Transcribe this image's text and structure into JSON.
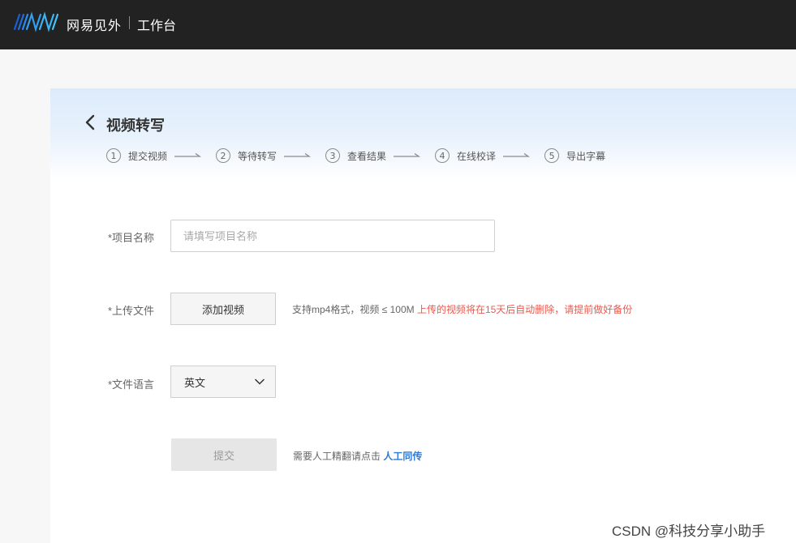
{
  "header": {
    "brand": "网易见外",
    "workbench": "工作台"
  },
  "page": {
    "title": "视频转写",
    "steps": [
      {
        "num": "1",
        "label": "提交视频"
      },
      {
        "num": "2",
        "label": "等待转写"
      },
      {
        "num": "3",
        "label": "查看结果"
      },
      {
        "num": "4",
        "label": "在线校译"
      },
      {
        "num": "5",
        "label": "导出字幕"
      }
    ]
  },
  "form": {
    "project_name": {
      "label": "*项目名称",
      "value": "",
      "placeholder": "请填写项目名称"
    },
    "upload": {
      "label": "*上传文件",
      "button": "添加视频",
      "hint": "支持mp4格式，视频 ≤ 100M ",
      "warning": "上传的视频将在15天后自动删除，请提前做好备份"
    },
    "language": {
      "label": "*文件语言",
      "value": "英文"
    },
    "submit": {
      "label": "提交"
    },
    "manual": {
      "text": "需要人工精翻请点击 ",
      "link": "人工同传"
    }
  },
  "watermark": "CSDN @科技分享小助手",
  "colors": {
    "topbar": "#222222",
    "warning": "#e85a4f",
    "link": "#2f7ad6",
    "logo_blue": "#2a8cf0"
  }
}
